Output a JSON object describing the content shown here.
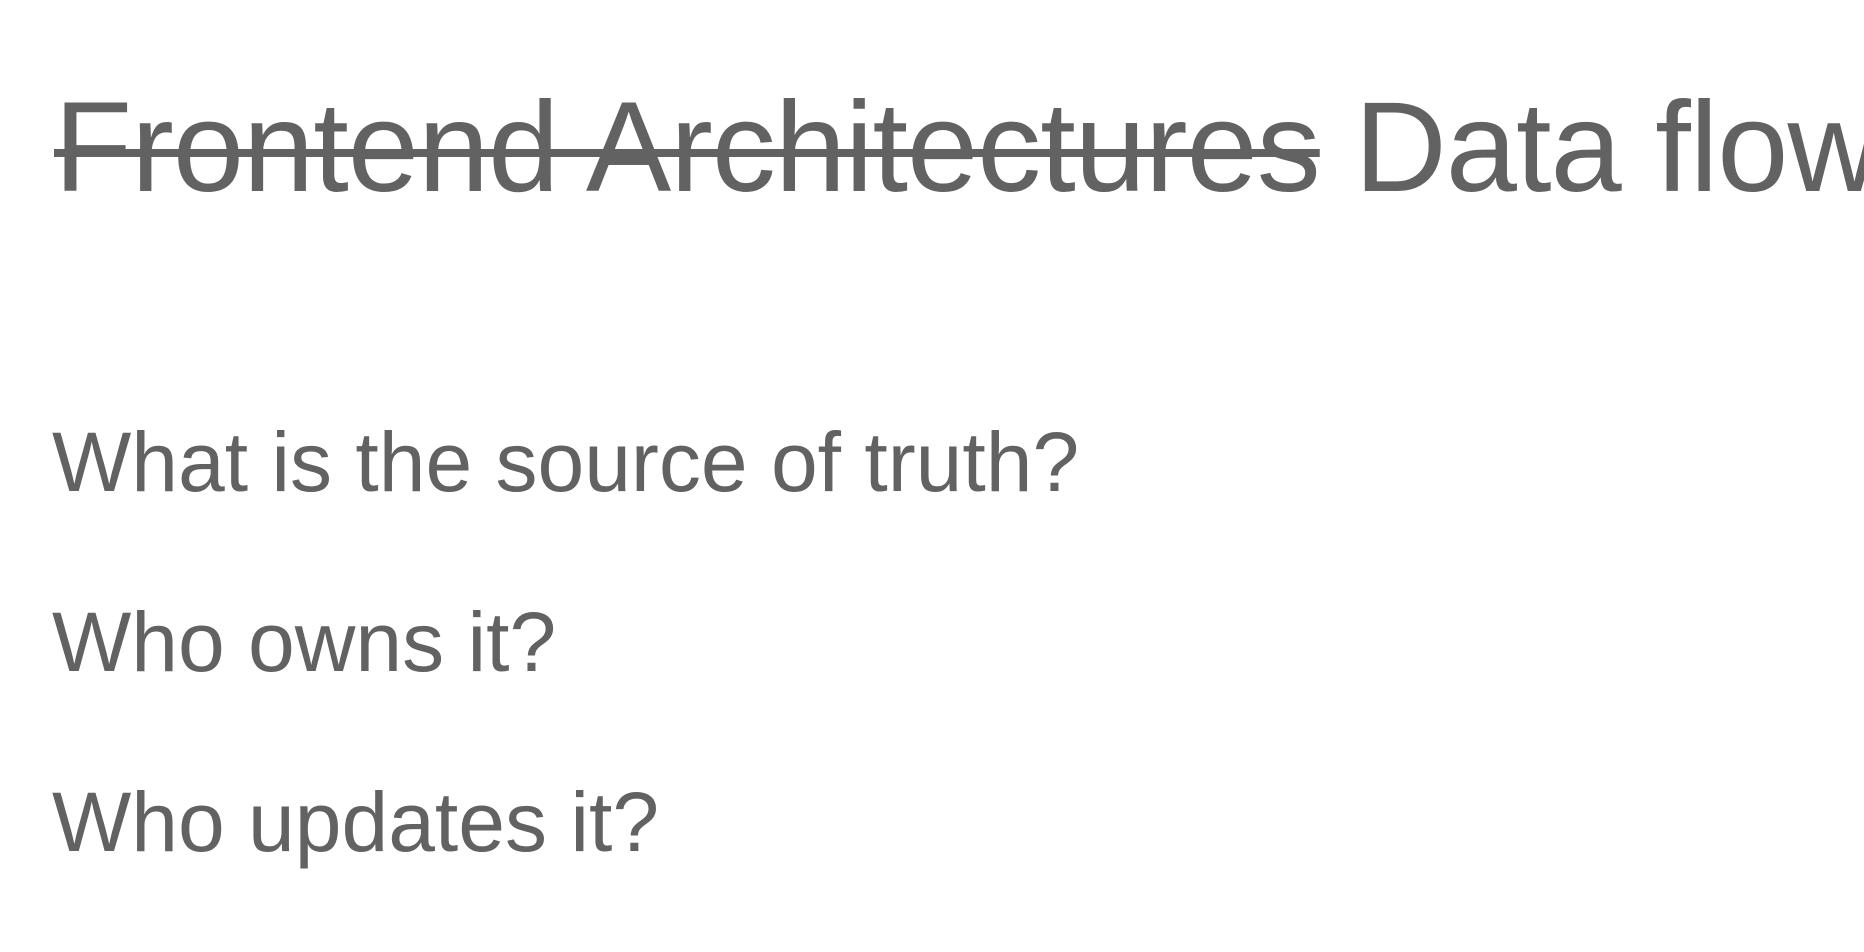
{
  "slide": {
    "title": {
      "struck_text": "Frontend Architectures",
      "replacement_text": "Data flow"
    },
    "questions": [
      "What is the source of truth?",
      "Who owns it?",
      "Who updates it?"
    ]
  },
  "colors": {
    "text": "#626262",
    "background": "#ffffff"
  }
}
